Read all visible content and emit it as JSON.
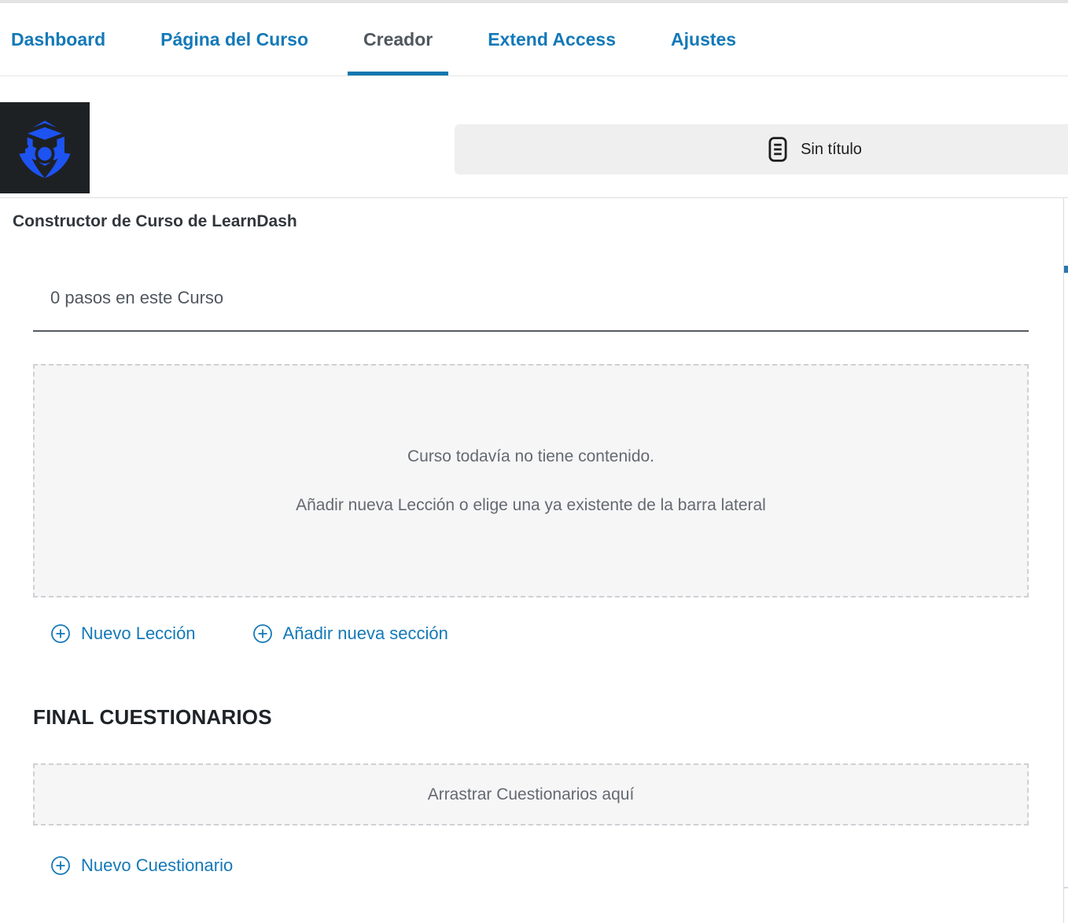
{
  "tabs": {
    "items": [
      {
        "label": "Dashboard",
        "active": false
      },
      {
        "label": "Página del Curso",
        "active": false
      },
      {
        "label": "Creador",
        "active": true
      },
      {
        "label": "Extend Access",
        "active": false
      },
      {
        "label": "Ajustes",
        "active": false
      }
    ]
  },
  "header": {
    "untitled_label": "Sin título"
  },
  "builder": {
    "title": "Constructor de Curso de LearnDash",
    "steps_count_text": "0 pasos en este Curso",
    "empty_line1": "Curso todavía no tiene contenido.",
    "empty_line2": "Añadir nueva Lección o elige una ya existente de la barra lateral",
    "new_lesson_label": "Nuevo Lección",
    "new_section_label": "Añadir nueva sección",
    "final_quizzes_heading": "FINAL CUESTIONARIOS",
    "quiz_dropzone_text": "Arrastrar Cuestionarios aquí",
    "new_quiz_label": "Nuevo Cuestionario"
  },
  "icons": {
    "logo": "graduation-cap-hexagon-logo",
    "untitled": "document-lines-icon",
    "add": "circle-plus-icon"
  },
  "colors": {
    "accent_blue": "#1479b8",
    "active_tab_underline": "#0f78ae",
    "heading_dark": "#1d2327",
    "muted_gray": "#646970",
    "logo_blue": "#1d53f1",
    "logo_background": "#1e2124",
    "dropzone_background": "#f6f6f7"
  }
}
